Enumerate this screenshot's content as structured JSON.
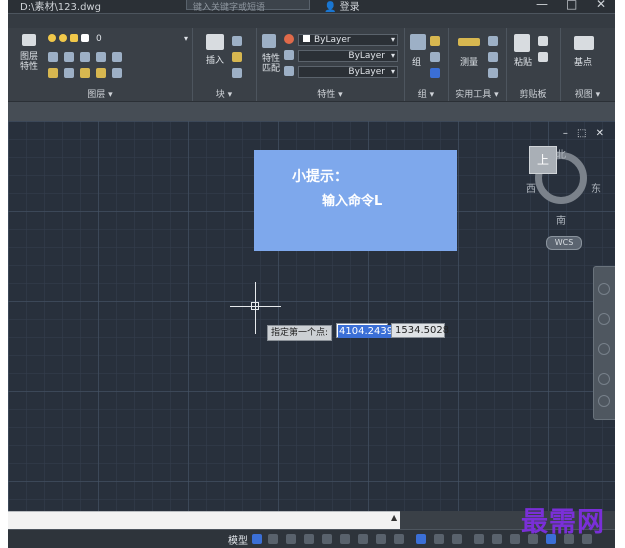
{
  "title_bar": {
    "file_path": "D:\\素材\\123.dwg",
    "search_placeholder": "键入关键字或短语",
    "login_label": "登录",
    "minimize": "—",
    "restore": "□",
    "close": "✕"
  },
  "ribbon": {
    "layers_panel": {
      "btn_layer_properties": "图层\n特性",
      "layer_name": "0",
      "title": "图层 ▾"
    },
    "block_panel": {
      "btn_insert": "插入",
      "title": "块 ▾"
    },
    "properties_panel": {
      "btn_match": "特性\n匹配",
      "color_value": "ByLayer",
      "linetype_value": "ByLayer",
      "lineweight_value": "ByLayer",
      "title": "特性 ▾"
    },
    "groups_panel": {
      "btn_group": "组",
      "title": "组 ▾"
    },
    "utilities_panel": {
      "btn_measure": "测量",
      "title": "实用工具 ▾"
    },
    "clipboard_panel": {
      "btn_paste": "粘贴",
      "title": "剪贴板"
    },
    "view_panel": {
      "btn_basepoint": "基点",
      "title": "视图 ▾"
    }
  },
  "canvas": {
    "viewport_controls": "– ⬚ ✕",
    "tip": {
      "title": "小提示：",
      "body": "输入命令L"
    },
    "viewcube": {
      "north": "北",
      "south": "南",
      "west": "西",
      "east": "东",
      "face": "上",
      "wcs": "WCS"
    },
    "dynamic_input": {
      "prompt": "指定第一个点:",
      "x_value": "4104.2439",
      "y_value": "1534.5028"
    }
  },
  "command_line": {
    "value": "",
    "arrow": "▲"
  },
  "status_bar": {
    "model_label": "模型"
  },
  "watermark": "最需网",
  "colors": {
    "canvas_bg": "#28303c",
    "tip_bg": "#7ea8ec",
    "ribbon_bg": "#3a4047",
    "watermark": "#7a2fd8",
    "highlight": "#3b6fd6"
  }
}
